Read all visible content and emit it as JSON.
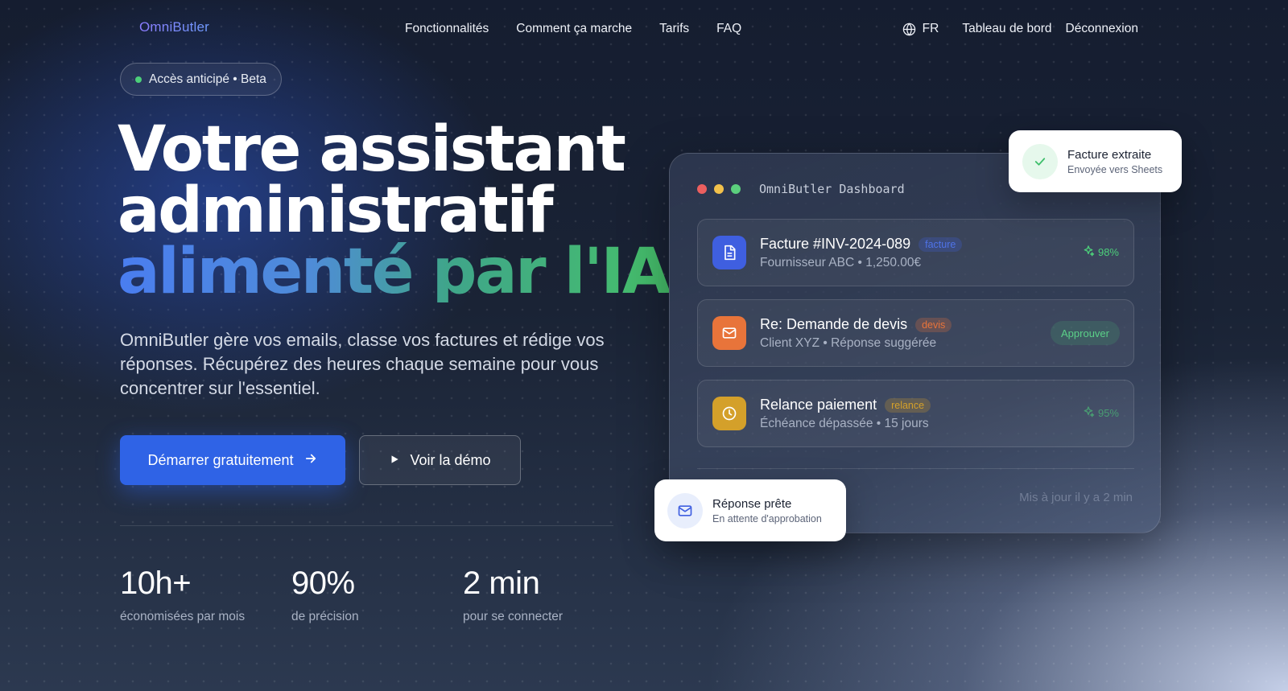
{
  "nav": {
    "logo": "OmniButler",
    "links": [
      "Fonctionnalités",
      "Comment ça marche",
      "Tarifs",
      "FAQ"
    ],
    "lang": "FR",
    "dashboard": "Tableau de bord",
    "logout": "Déconnexion"
  },
  "hero": {
    "badge": "Accès anticipé • Beta",
    "line1": "Votre assistant",
    "line2": "administratif",
    "line3": "alimenté par l'IA",
    "subtitle": "OmniButler gère vos emails, classe vos factures et rédige vos réponses. Récupérez des heures chaque semaine pour vous concentrer sur l'essentiel.",
    "cta_primary": "Démarrer gratuitement",
    "cta_secondary": "Voir la démo"
  },
  "stats": [
    {
      "value": "10h+",
      "label": "économisées par mois"
    },
    {
      "value": "90%",
      "label": "de précision"
    },
    {
      "value": "2 min",
      "label": "pour se connecter"
    }
  ],
  "dashboard": {
    "title": "OmniButler Dashboard",
    "items": [
      {
        "title": "Facture #INV-2024-089",
        "tag": "facture",
        "sub": "Fournisseur ABC • 1,250.00€",
        "right": "98%"
      },
      {
        "title": "Re: Demande de devis",
        "tag": "devis",
        "sub": "Client XYZ • Réponse suggérée",
        "right": "Approuver"
      },
      {
        "title": "Relance paiement",
        "tag": "relance",
        "sub": "Échéance dépassée • 15 jours",
        "right": "95%"
      }
    ],
    "updated": "Mis à jour il y a 2 min"
  },
  "toasts": {
    "invoice": {
      "title": "Facture extraite",
      "sub": "Envoyée vers Sheets"
    },
    "reply": {
      "title": "Réponse prête",
      "sub": "En attente d'approbation"
    }
  },
  "colors": {
    "primary": "#2f63e6",
    "accent_green": "#4ccf7a",
    "invoice_icon": "#3f5fe0",
    "quote_icon": "#e8743a",
    "reminder_icon": "#d4a02a"
  }
}
